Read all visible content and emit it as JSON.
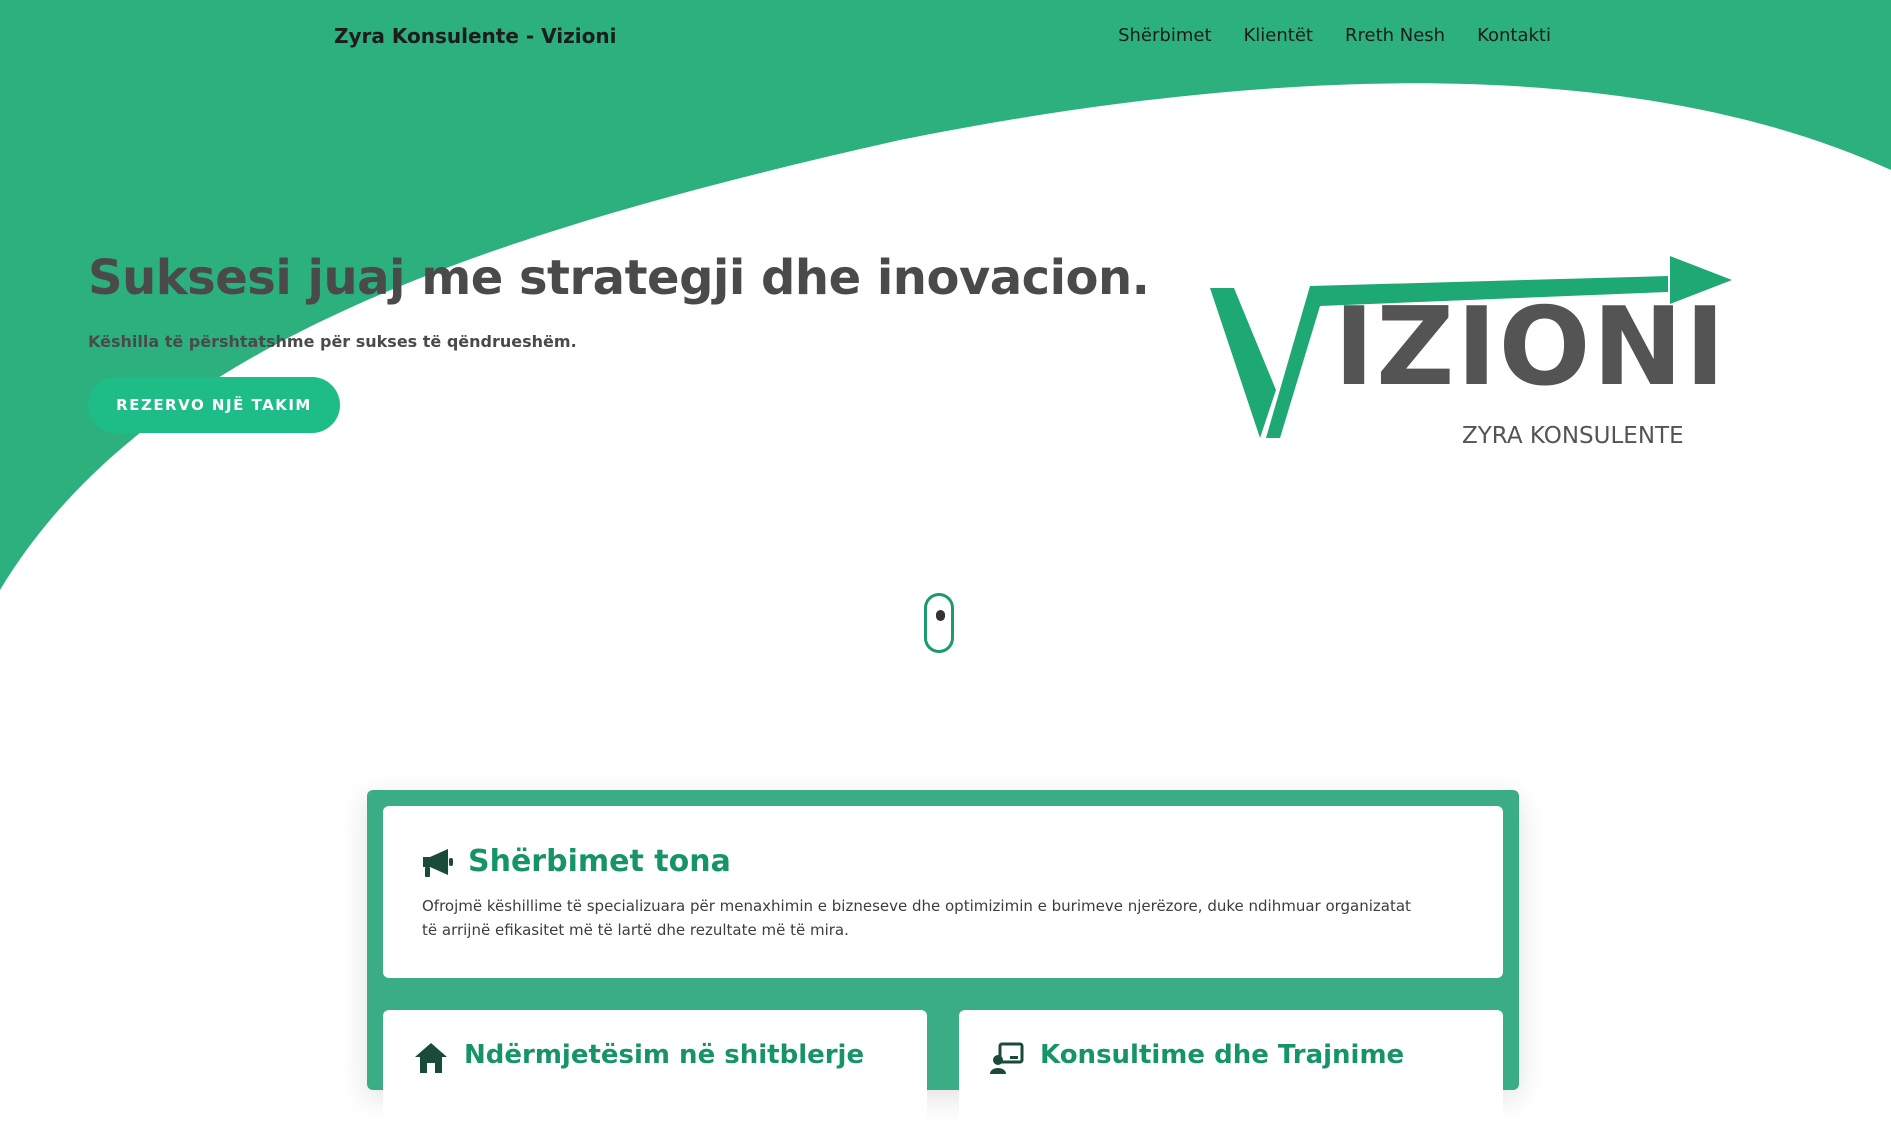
{
  "nav": {
    "brand": "Zyra Konsulente - Vizioni",
    "links": [
      "Shërbimet",
      "Klientët",
      "Rreth Nesh",
      "Kontakti"
    ]
  },
  "hero": {
    "title": "Suksesi juaj me strategji dhe inovacion.",
    "subtitle": "Këshilla të përshtatshme për sukses të qëndrueshëm.",
    "cta_label": "REZERVO NJË TAKIM"
  },
  "logo": {
    "main": "VIZIONI",
    "sub": "ZYRA KONSULENTE"
  },
  "services": {
    "main": {
      "icon": "megaphone-icon",
      "title": "Shërbimet tona",
      "text": "Ofrojmë këshillime të specializuara për menaxhimin e bizneseve dhe optimizimin e burimeve njerëzore, duke ndihmuar organizatat të arrijnë efikasitet më të lartë dhe rezultate më të mira."
    },
    "cards": [
      {
        "icon": "home-icon",
        "title": "Ndërmjetësim në shitblerje"
      },
      {
        "icon": "presentation-icon",
        "title": "Konsultime dhe Trajnime"
      }
    ]
  },
  "colors": {
    "brand_green": "#2bb07e",
    "button_green": "#1ebc86",
    "panel_green": "#3aad86",
    "title_green": "#169468",
    "text_dark": "#4a4a4a"
  }
}
